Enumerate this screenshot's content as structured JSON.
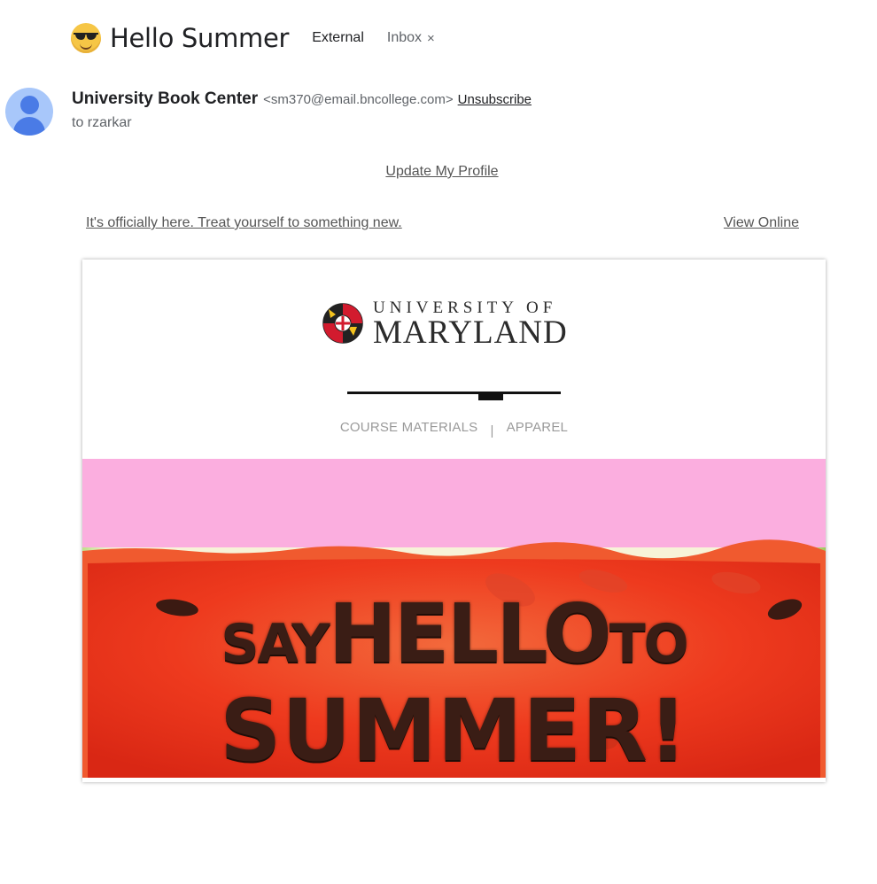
{
  "email": {
    "subject": "Hello Summer",
    "labels": {
      "external": "External",
      "inbox": "Inbox",
      "remove_label": "×"
    },
    "sender": {
      "name": "University Book Center",
      "email": "<sm370@email.bncollege.com>",
      "unsubscribe": "Unsubscribe",
      "to": "to rzarkar"
    }
  },
  "body": {
    "update_profile": "Update My Profile",
    "preheader": "It's officially here. Treat yourself to something new.",
    "view_online": "View Online",
    "logo": {
      "top": "UNIVERSITY OF",
      "bottom": "MARYLAND"
    },
    "nav": {
      "course_materials": "COURSE MATERIALS",
      "separator": "|",
      "apparel": "APPAREL"
    },
    "hero": {
      "say": "SAY",
      "hello": "HELLO",
      "to": "TO",
      "summer": "SUMMER!"
    }
  },
  "icons": {
    "emoji": "sunglasses-emoji-icon",
    "avatar": "default-avatar-icon",
    "seal": "maryland-seal-icon"
  },
  "colors": {
    "hero_pink": "#fbaedf",
    "watermelon_red": "#ee3a1e",
    "text_dark": "#202124"
  }
}
